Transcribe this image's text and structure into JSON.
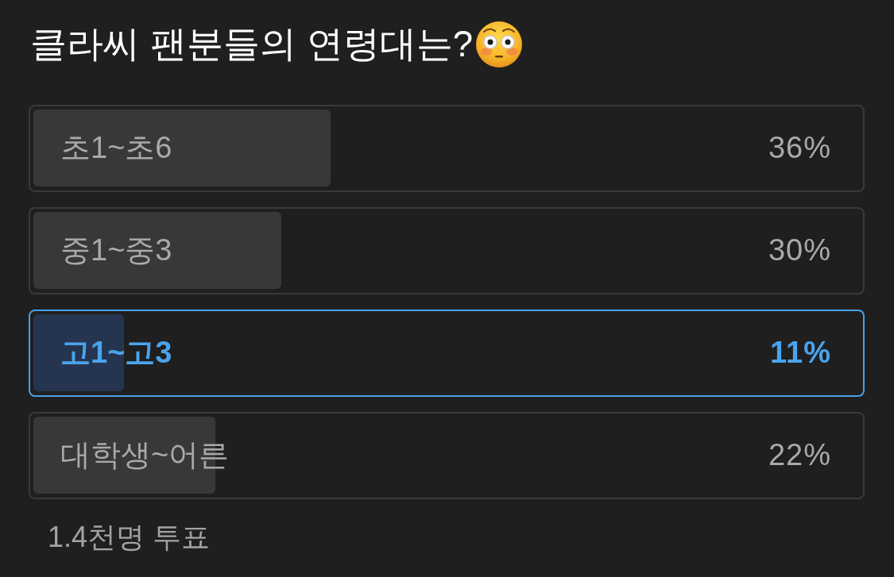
{
  "question": {
    "title": "클라씨 팬분들의 연령대는?"
  },
  "options": [
    {
      "label": "초1~초6",
      "percent": "36%",
      "level": 0.36,
      "selected": false
    },
    {
      "label": "중1~중3",
      "percent": "30%",
      "level": 0.3,
      "selected": false
    },
    {
      "label": "고1~고3",
      "percent": "11%",
      "level": 0.11,
      "selected": true
    },
    {
      "label": "대학생~어른",
      "percent": "22%",
      "level": 0.22,
      "selected": false
    }
  ],
  "footer": {
    "votes": "1.4천명 투표"
  }
}
